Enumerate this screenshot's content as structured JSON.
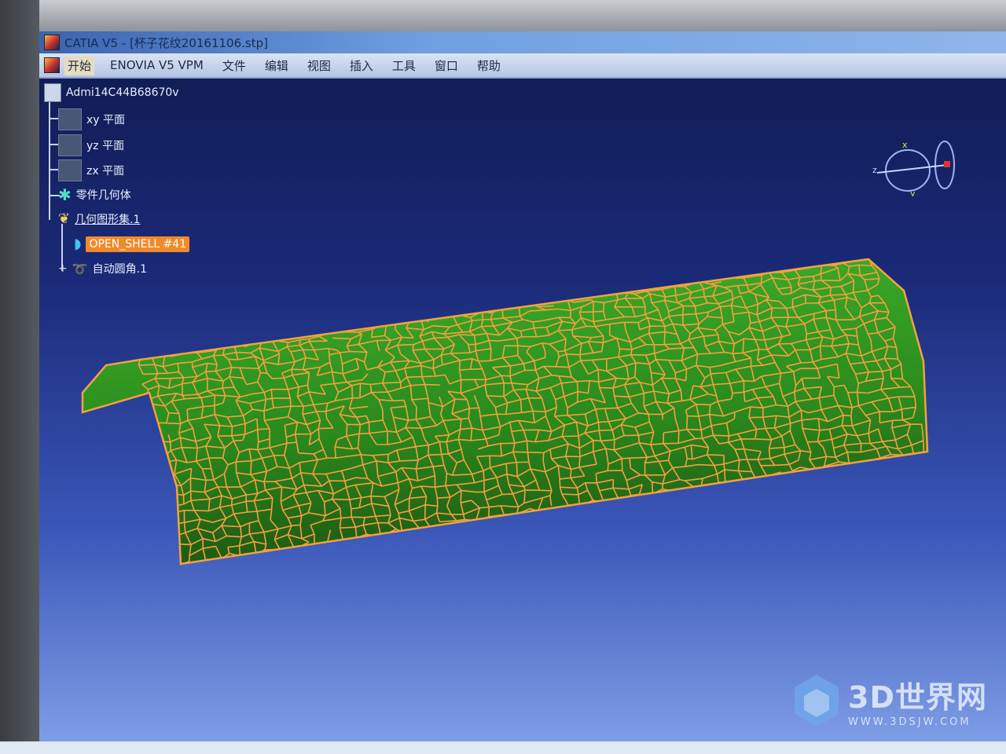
{
  "window": {
    "title": "CATIA V5 - [杯子花纹20161106.stp]"
  },
  "menu": [
    "开始",
    "ENOVIA V5 VPM",
    "文件",
    "编辑",
    "视图",
    "插入",
    "工具",
    "窗口",
    "帮助"
  ],
  "tree": {
    "root": "Admi14C44B68670v",
    "items": [
      "xy 平面",
      "yz 平面",
      "zx 平面",
      "零件几何体",
      "几何图形集.1",
      "OPEN_SHELL #41",
      "自动圆角.1"
    ]
  },
  "compass": {
    "x": "x",
    "y": "y",
    "z": "z"
  },
  "watermark": {
    "main": "3D世界网",
    "sub": "WWW.3DSJW.COM"
  },
  "colors": {
    "mesh": "#f5a040",
    "surface": "#2f9a1e",
    "selection": "#f08a2a"
  }
}
